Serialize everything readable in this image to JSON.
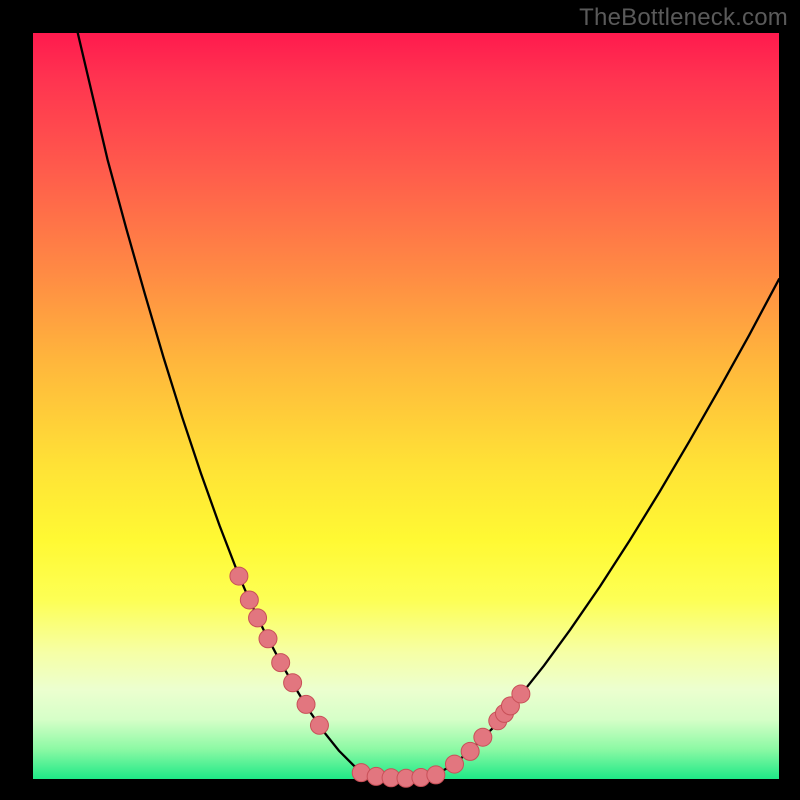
{
  "watermark": "TheBottleneck.com",
  "chart_data": {
    "type": "line",
    "title": "",
    "xlabel": "",
    "ylabel": "",
    "xlim": [
      0,
      100
    ],
    "ylim": [
      0,
      100
    ],
    "series": [
      {
        "name": "curve-left",
        "x": [
          6.0,
          8.0,
          10.0,
          12.5,
          15.0,
          17.5,
          20.0,
          22.5,
          25.0,
          27.5,
          29.0,
          31.0,
          33.0,
          35.0,
          37.0,
          39.0,
          41.0,
          43.0,
          45.0
        ],
        "y": [
          100.0,
          91.5,
          83.0,
          73.8,
          65.0,
          56.5,
          48.5,
          41.0,
          34.0,
          27.5,
          24.0,
          19.8,
          16.0,
          12.5,
          9.2,
          6.3,
          3.8,
          1.8,
          0.6
        ]
      },
      {
        "name": "curve-bottom",
        "x": [
          45.0,
          46.5,
          48.0,
          49.5,
          51.0,
          52.5,
          54.0
        ],
        "y": [
          0.6,
          0.25,
          0.12,
          0.08,
          0.12,
          0.25,
          0.6
        ]
      },
      {
        "name": "curve-right",
        "x": [
          54.0,
          56.5,
          59.0,
          62.0,
          65.0,
          68.5,
          72.0,
          76.0,
          80.0,
          84.0,
          88.0,
          92.0,
          96.0,
          100.0
        ],
        "y": [
          0.6,
          2.0,
          4.2,
          7.2,
          10.8,
          15.2,
          20.0,
          25.8,
          32.0,
          38.5,
          45.3,
          52.3,
          59.5,
          67.0
        ]
      }
    ],
    "markers": [
      {
        "name": "dots-left",
        "x": [
          27.6,
          29.0,
          30.1,
          31.5,
          33.2,
          34.8,
          36.6,
          38.4
        ],
        "y": [
          27.2,
          24.0,
          21.6,
          18.8,
          15.6,
          12.9,
          10.0,
          7.2
        ]
      },
      {
        "name": "dots-bottom",
        "x": [
          44.0,
          46.0,
          48.0,
          50.0,
          52.0,
          54.0
        ],
        "y": [
          0.85,
          0.35,
          0.16,
          0.1,
          0.2,
          0.55
        ]
      },
      {
        "name": "dots-right",
        "x": [
          56.5,
          58.6,
          60.3,
          62.3,
          63.2,
          64.0,
          65.4
        ],
        "y": [
          2.0,
          3.7,
          5.6,
          7.8,
          8.8,
          9.8,
          11.4
        ]
      }
    ],
    "marker_style": {
      "fill": "#e2767f",
      "stroke": "#c85058",
      "r": 9
    }
  }
}
